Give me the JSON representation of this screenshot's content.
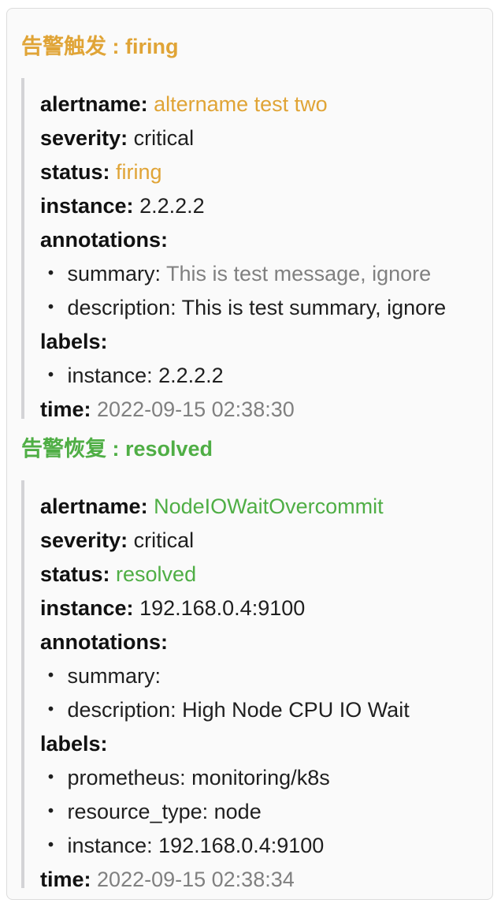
{
  "colors": {
    "firing_accent": "#e0a436",
    "resolved_accent": "#4fae45",
    "muted_text": "#808080",
    "quote_bar": "#d3d3d6"
  },
  "alerts": [
    {
      "heading": "告警触发 : firing",
      "alertname_label": "alertname:",
      "alertname": "altername test two",
      "severity_label": "severity:",
      "severity": "critical",
      "status_label": "status:",
      "status": "firing",
      "instance_label": "instance:",
      "instance": "2.2.2.2",
      "annotations_label": "annotations:",
      "annotations": [
        {
          "bullet": "・",
          "key": "summary:",
          "value": "This is test message, ignore"
        },
        {
          "bullet": "・",
          "key": "description:",
          "value": "This is test summary, ignore"
        }
      ],
      "labels_label": "labels:",
      "labels": [
        {
          "bullet": "・",
          "key": "instance:",
          "value": "2.2.2.2"
        }
      ],
      "time_label": "time:",
      "time": "2022-09-15 02:38:30"
    },
    {
      "heading": "告警恢复 : resolved",
      "alertname_label": "alertname:",
      "alertname": "NodeIOWaitOvercommit",
      "severity_label": "severity:",
      "severity": "critical",
      "status_label": "status:",
      "status": "resolved",
      "instance_label": "instance:",
      "instance": "192.168.0.4:9100",
      "annotations_label": "annotations:",
      "annotations": [
        {
          "bullet": "・",
          "key": "summary:",
          "value": ""
        },
        {
          "bullet": "・",
          "key": "description:",
          "value": "High Node CPU IO Wait"
        }
      ],
      "labels_label": "labels:",
      "labels": [
        {
          "bullet": "・",
          "key": "prometheus:",
          "value": "monitoring/k8s"
        },
        {
          "bullet": "・",
          "key": "resource_type:",
          "value": "node"
        },
        {
          "bullet": "・",
          "key": "instance:",
          "value": "192.168.0.4:9100"
        }
      ],
      "time_label": "time:",
      "time": "2022-09-15 02:38:34"
    }
  ]
}
